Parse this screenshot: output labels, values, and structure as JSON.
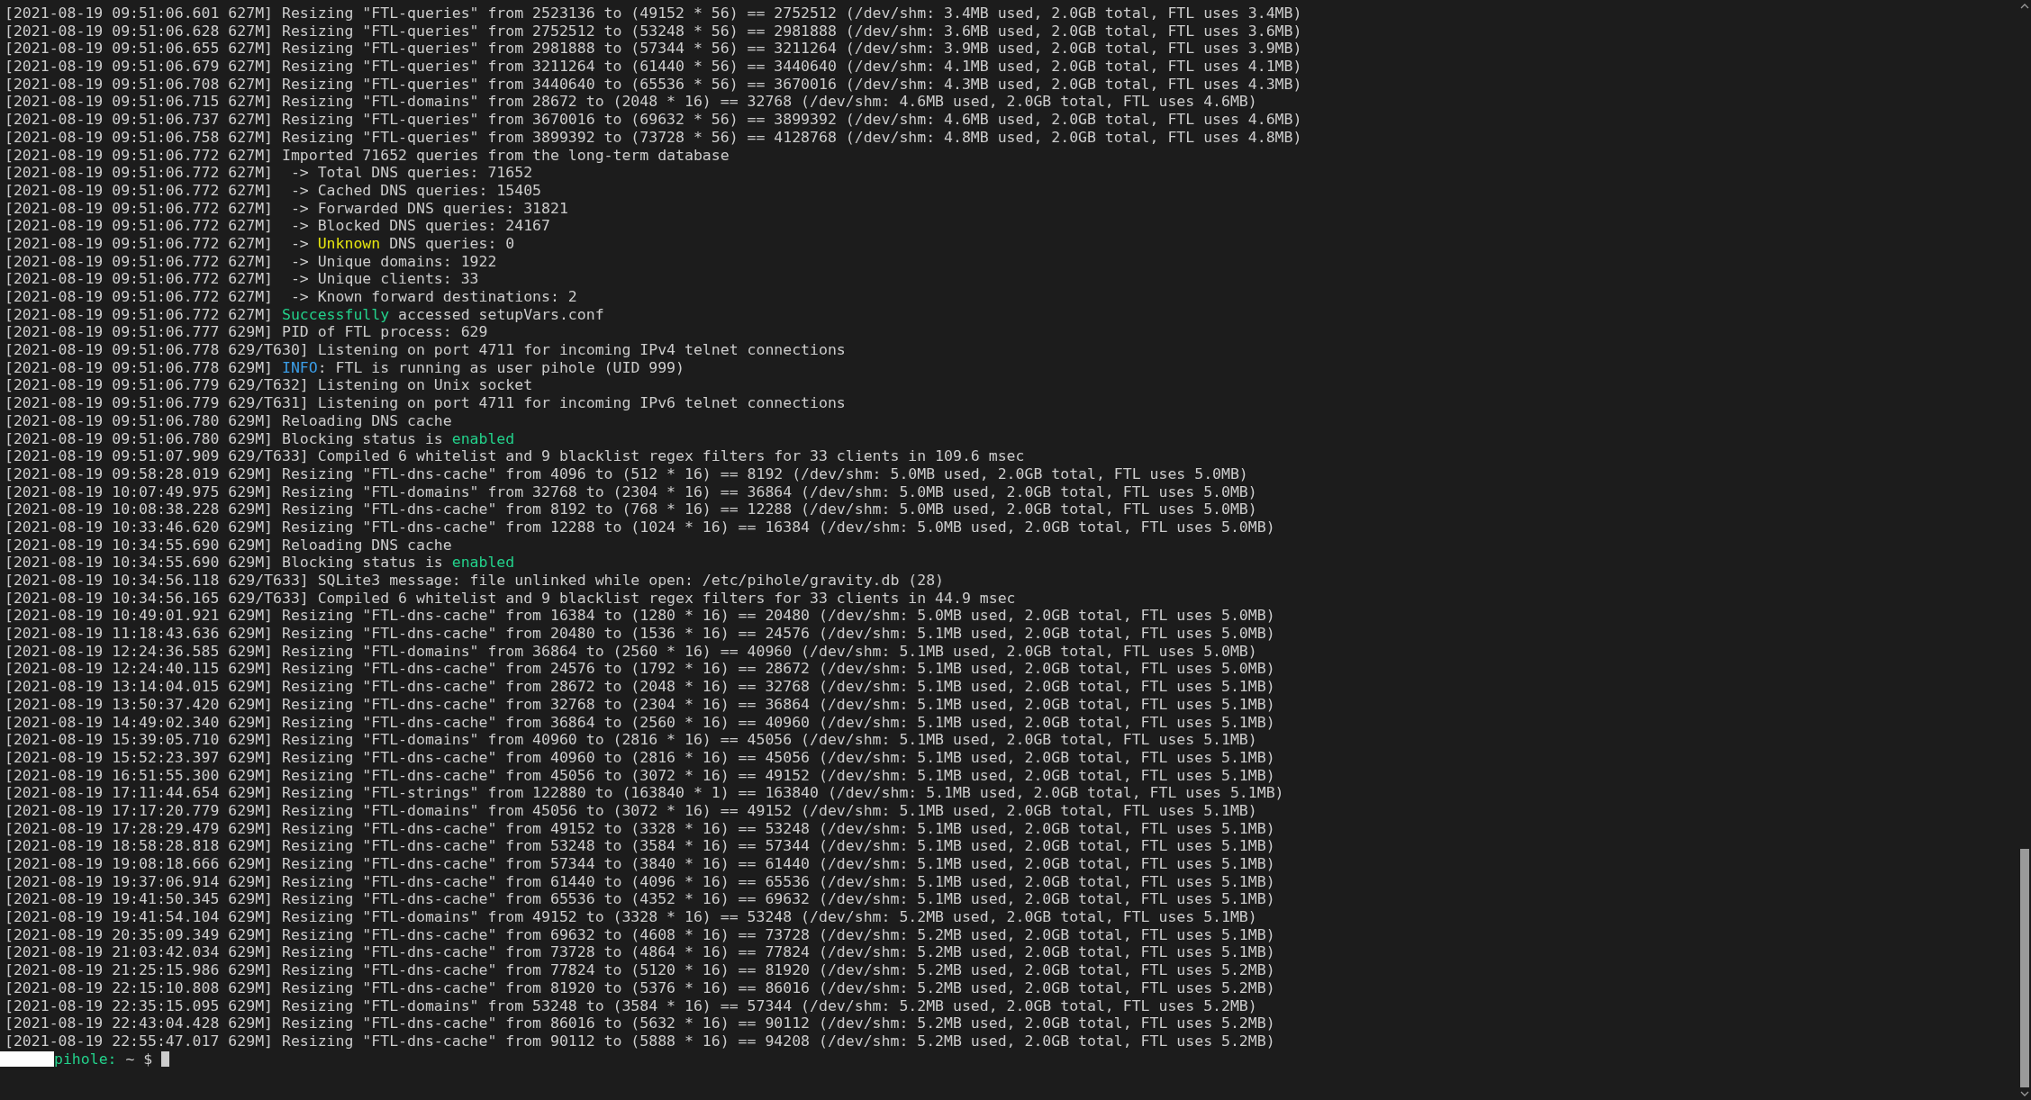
{
  "terminal": {
    "lines": [
      {
        "text": "[2021-08-19 09:51:06.601 627M] Resizing \"FTL-queries\" from 2523136 to (49152 * 56) == 2752512 (/dev/shm: 3.4MB used, 2.0GB total, FTL uses 3.4MB)"
      },
      {
        "text": "[2021-08-19 09:51:06.628 627M] Resizing \"FTL-queries\" from 2752512 to (53248 * 56) == 2981888 (/dev/shm: 3.6MB used, 2.0GB total, FTL uses 3.6MB)"
      },
      {
        "text": "[2021-08-19 09:51:06.655 627M] Resizing \"FTL-queries\" from 2981888 to (57344 * 56) == 3211264 (/dev/shm: 3.9MB used, 2.0GB total, FTL uses 3.9MB)"
      },
      {
        "text": "[2021-08-19 09:51:06.679 627M] Resizing \"FTL-queries\" from 3211264 to (61440 * 56) == 3440640 (/dev/shm: 4.1MB used, 2.0GB total, FTL uses 4.1MB)"
      },
      {
        "text": "[2021-08-19 09:51:06.708 627M] Resizing \"FTL-queries\" from 3440640 to (65536 * 56) == 3670016 (/dev/shm: 4.3MB used, 2.0GB total, FTL uses 4.3MB)"
      },
      {
        "text": "[2021-08-19 09:51:06.715 627M] Resizing \"FTL-domains\" from 28672 to (2048 * 16) == 32768 (/dev/shm: 4.6MB used, 2.0GB total, FTL uses 4.6MB)"
      },
      {
        "text": "[2021-08-19 09:51:06.737 627M] Resizing \"FTL-queries\" from 3670016 to (69632 * 56) == 3899392 (/dev/shm: 4.6MB used, 2.0GB total, FTL uses 4.6MB)"
      },
      {
        "text": "[2021-08-19 09:51:06.758 627M] Resizing \"FTL-queries\" from 3899392 to (73728 * 56) == 4128768 (/dev/shm: 4.8MB used, 2.0GB total, FTL uses 4.8MB)"
      },
      {
        "text": "[2021-08-19 09:51:06.772 627M] Imported 71652 queries from the long-term database"
      },
      {
        "text": "[2021-08-19 09:51:06.772 627M]  -> Total DNS queries: 71652"
      },
      {
        "text": "[2021-08-19 09:51:06.772 627M]  -> Cached DNS queries: 15405"
      },
      {
        "text": "[2021-08-19 09:51:06.772 627M]  -> Forwarded DNS queries: 31821"
      },
      {
        "text": "[2021-08-19 09:51:06.772 627M]  -> Blocked DNS queries: 24167"
      },
      {
        "segments": [
          {
            "text": "[2021-08-19 09:51:06.772 627M]  -> "
          },
          {
            "text": "Unknown",
            "color": "#e5e510"
          },
          {
            "text": " DNS queries: 0"
          }
        ]
      },
      {
        "text": "[2021-08-19 09:51:06.772 627M]  -> Unique domains: 1922"
      },
      {
        "text": "[2021-08-19 09:51:06.772 627M]  -> Unique clients: 33"
      },
      {
        "text": "[2021-08-19 09:51:06.772 627M]  -> Known forward destinations: 2"
      },
      {
        "segments": [
          {
            "text": "[2021-08-19 09:51:06.772 627M] "
          },
          {
            "text": "Successfully",
            "color": "#23d18b"
          },
          {
            "text": " accessed setupVars.conf"
          }
        ]
      },
      {
        "text": "[2021-08-19 09:51:06.777 629M] PID of FTL process: 629"
      },
      {
        "text": "[2021-08-19 09:51:06.778 629/T630] Listening on port 4711 for incoming IPv4 telnet connections"
      },
      {
        "segments": [
          {
            "text": "[2021-08-19 09:51:06.778 629M] "
          },
          {
            "text": "INFO",
            "color": "#3b9ee8"
          },
          {
            "text": ": FTL is running as user pihole (UID 999)"
          }
        ]
      },
      {
        "text": "[2021-08-19 09:51:06.779 629/T632] Listening on Unix socket"
      },
      {
        "text": "[2021-08-19 09:51:06.779 629/T631] Listening on port 4711 for incoming IPv6 telnet connections"
      },
      {
        "text": "[2021-08-19 09:51:06.780 629M] Reloading DNS cache"
      },
      {
        "segments": [
          {
            "text": "[2021-08-19 09:51:06.780 629M] Blocking status is "
          },
          {
            "text": "enabled",
            "color": "#23d18b"
          }
        ]
      },
      {
        "text": "[2021-08-19 09:51:07.909 629/T633] Compiled 6 whitelist and 9 blacklist regex filters for 33 clients in 109.6 msec"
      },
      {
        "text": "[2021-08-19 09:58:28.019 629M] Resizing \"FTL-dns-cache\" from 4096 to (512 * 16) == 8192 (/dev/shm: 5.0MB used, 2.0GB total, FTL uses 5.0MB)"
      },
      {
        "text": "[2021-08-19 10:07:49.975 629M] Resizing \"FTL-domains\" from 32768 to (2304 * 16) == 36864 (/dev/shm: 5.0MB used, 2.0GB total, FTL uses 5.0MB)"
      },
      {
        "text": "[2021-08-19 10:08:38.228 629M] Resizing \"FTL-dns-cache\" from 8192 to (768 * 16) == 12288 (/dev/shm: 5.0MB used, 2.0GB total, FTL uses 5.0MB)"
      },
      {
        "text": "[2021-08-19 10:33:46.620 629M] Resizing \"FTL-dns-cache\" from 12288 to (1024 * 16) == 16384 (/dev/shm: 5.0MB used, 2.0GB total, FTL uses 5.0MB)"
      },
      {
        "text": "[2021-08-19 10:34:55.690 629M] Reloading DNS cache"
      },
      {
        "segments": [
          {
            "text": "[2021-08-19 10:34:55.690 629M] Blocking status is "
          },
          {
            "text": "enabled",
            "color": "#23d18b"
          }
        ]
      },
      {
        "text": "[2021-08-19 10:34:56.118 629/T633] SQLite3 message: file unlinked while open: /etc/pihole/gravity.db (28)"
      },
      {
        "text": "[2021-08-19 10:34:56.165 629/T633] Compiled 6 whitelist and 9 blacklist regex filters for 33 clients in 44.9 msec"
      },
      {
        "text": "[2021-08-19 10:49:01.921 629M] Resizing \"FTL-dns-cache\" from 16384 to (1280 * 16) == 20480 (/dev/shm: 5.0MB used, 2.0GB total, FTL uses 5.0MB)"
      },
      {
        "text": "[2021-08-19 11:18:43.636 629M] Resizing \"FTL-dns-cache\" from 20480 to (1536 * 16) == 24576 (/dev/shm: 5.1MB used, 2.0GB total, FTL uses 5.0MB)"
      },
      {
        "text": "[2021-08-19 12:24:36.585 629M] Resizing \"FTL-domains\" from 36864 to (2560 * 16) == 40960 (/dev/shm: 5.1MB used, 2.0GB total, FTL uses 5.0MB)"
      },
      {
        "text": "[2021-08-19 12:24:40.115 629M] Resizing \"FTL-dns-cache\" from 24576 to (1792 * 16) == 28672 (/dev/shm: 5.1MB used, 2.0GB total, FTL uses 5.0MB)"
      },
      {
        "text": "[2021-08-19 13:14:04.015 629M] Resizing \"FTL-dns-cache\" from 28672 to (2048 * 16) == 32768 (/dev/shm: 5.1MB used, 2.0GB total, FTL uses 5.1MB)"
      },
      {
        "text": "[2021-08-19 13:50:37.420 629M] Resizing \"FTL-dns-cache\" from 32768 to (2304 * 16) == 36864 (/dev/shm: 5.1MB used, 2.0GB total, FTL uses 5.1MB)"
      },
      {
        "text": "[2021-08-19 14:49:02.340 629M] Resizing \"FTL-dns-cache\" from 36864 to (2560 * 16) == 40960 (/dev/shm: 5.1MB used, 2.0GB total, FTL uses 5.1MB)"
      },
      {
        "text": "[2021-08-19 15:39:05.710 629M] Resizing \"FTL-domains\" from 40960 to (2816 * 16) == 45056 (/dev/shm: 5.1MB used, 2.0GB total, FTL uses 5.1MB)"
      },
      {
        "text": "[2021-08-19 15:52:23.397 629M] Resizing \"FTL-dns-cache\" from 40960 to (2816 * 16) == 45056 (/dev/shm: 5.1MB used, 2.0GB total, FTL uses 5.1MB)"
      },
      {
        "text": "[2021-08-19 16:51:55.300 629M] Resizing \"FTL-dns-cache\" from 45056 to (3072 * 16) == 49152 (/dev/shm: 5.1MB used, 2.0GB total, FTL uses 5.1MB)"
      },
      {
        "text": "[2021-08-19 17:11:44.654 629M] Resizing \"FTL-strings\" from 122880 to (163840 * 1) == 163840 (/dev/shm: 5.1MB used, 2.0GB total, FTL uses 5.1MB)"
      },
      {
        "text": "[2021-08-19 17:17:20.779 629M] Resizing \"FTL-domains\" from 45056 to (3072 * 16) == 49152 (/dev/shm: 5.1MB used, 2.0GB total, FTL uses 5.1MB)"
      },
      {
        "text": "[2021-08-19 17:28:29.479 629M] Resizing \"FTL-dns-cache\" from 49152 to (3328 * 16) == 53248 (/dev/shm: 5.1MB used, 2.0GB total, FTL uses 5.1MB)"
      },
      {
        "text": "[2021-08-19 18:58:28.818 629M] Resizing \"FTL-dns-cache\" from 53248 to (3584 * 16) == 57344 (/dev/shm: 5.1MB used, 2.0GB total, FTL uses 5.1MB)"
      },
      {
        "text": "[2021-08-19 19:08:18.666 629M] Resizing \"FTL-dns-cache\" from 57344 to (3840 * 16) == 61440 (/dev/shm: 5.1MB used, 2.0GB total, FTL uses 5.1MB)"
      },
      {
        "text": "[2021-08-19 19:37:06.914 629M] Resizing \"FTL-dns-cache\" from 61440 to (4096 * 16) == 65536 (/dev/shm: 5.1MB used, 2.0GB total, FTL uses 5.1MB)"
      },
      {
        "text": "[2021-08-19 19:41:50.345 629M] Resizing \"FTL-dns-cache\" from 65536 to (4352 * 16) == 69632 (/dev/shm: 5.1MB used, 2.0GB total, FTL uses 5.1MB)"
      },
      {
        "text": "[2021-08-19 19:41:54.104 629M] Resizing \"FTL-domains\" from 49152 to (3328 * 16) == 53248 (/dev/shm: 5.2MB used, 2.0GB total, FTL uses 5.1MB)"
      },
      {
        "text": "[2021-08-19 20:35:09.349 629M] Resizing \"FTL-dns-cache\" from 69632 to (4608 * 16) == 73728 (/dev/shm: 5.2MB used, 2.0GB total, FTL uses 5.1MB)"
      },
      {
        "text": "[2021-08-19 21:03:42.034 629M] Resizing \"FTL-dns-cache\" from 73728 to (4864 * 16) == 77824 (/dev/shm: 5.2MB used, 2.0GB total, FTL uses 5.1MB)"
      },
      {
        "text": "[2021-08-19 21:25:15.986 629M] Resizing \"FTL-dns-cache\" from 77824 to (5120 * 16) == 81920 (/dev/shm: 5.2MB used, 2.0GB total, FTL uses 5.2MB)"
      },
      {
        "text": "[2021-08-19 22:15:10.808 629M] Resizing \"FTL-dns-cache\" from 81920 to (5376 * 16) == 86016 (/dev/shm: 5.2MB used, 2.0GB total, FTL uses 5.2MB)"
      },
      {
        "text": "[2021-08-19 22:35:15.095 629M] Resizing \"FTL-domains\" from 53248 to (3584 * 16) == 57344 (/dev/shm: 5.2MB used, 2.0GB total, FTL uses 5.2MB)"
      },
      {
        "text": "[2021-08-19 22:43:04.428 629M] Resizing \"FTL-dns-cache\" from 86016 to (5632 * 16) == 90112 (/dev/shm: 5.2MB used, 2.0GB total, FTL uses 5.2MB)"
      },
      {
        "text": "[2021-08-19 22:55:47.017 629M] Resizing \"FTL-dns-cache\" from 90112 to (5888 * 16) == 94208 (/dev/shm: 5.2MB used, 2.0GB total, FTL uses 5.2MB)"
      }
    ],
    "prompt": {
      "host": "pihole:",
      "path": "~ $"
    }
  }
}
